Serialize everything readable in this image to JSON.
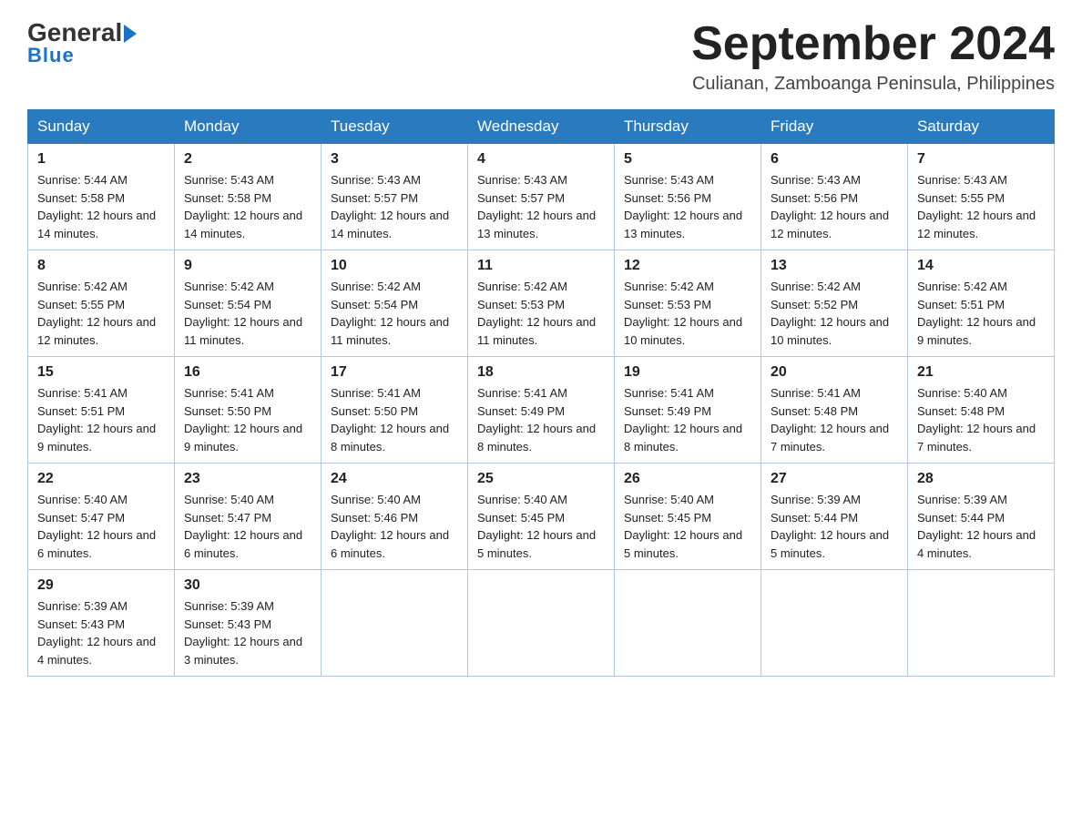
{
  "logo": {
    "general": "General",
    "blue": "Blue",
    "arrow": "▶"
  },
  "title": "September 2024",
  "location": "Culianan, Zamboanga Peninsula, Philippines",
  "weekdays": [
    "Sunday",
    "Monday",
    "Tuesday",
    "Wednesday",
    "Thursday",
    "Friday",
    "Saturday"
  ],
  "weeks": [
    [
      {
        "day": "1",
        "sunrise": "5:44 AM",
        "sunset": "5:58 PM",
        "daylight": "12 hours and 14 minutes."
      },
      {
        "day": "2",
        "sunrise": "5:43 AM",
        "sunset": "5:58 PM",
        "daylight": "12 hours and 14 minutes."
      },
      {
        "day": "3",
        "sunrise": "5:43 AM",
        "sunset": "5:57 PM",
        "daylight": "12 hours and 14 minutes."
      },
      {
        "day": "4",
        "sunrise": "5:43 AM",
        "sunset": "5:57 PM",
        "daylight": "12 hours and 13 minutes."
      },
      {
        "day": "5",
        "sunrise": "5:43 AM",
        "sunset": "5:56 PM",
        "daylight": "12 hours and 13 minutes."
      },
      {
        "day": "6",
        "sunrise": "5:43 AM",
        "sunset": "5:56 PM",
        "daylight": "12 hours and 12 minutes."
      },
      {
        "day": "7",
        "sunrise": "5:43 AM",
        "sunset": "5:55 PM",
        "daylight": "12 hours and 12 minutes."
      }
    ],
    [
      {
        "day": "8",
        "sunrise": "5:42 AM",
        "sunset": "5:55 PM",
        "daylight": "12 hours and 12 minutes."
      },
      {
        "day": "9",
        "sunrise": "5:42 AM",
        "sunset": "5:54 PM",
        "daylight": "12 hours and 11 minutes."
      },
      {
        "day": "10",
        "sunrise": "5:42 AM",
        "sunset": "5:54 PM",
        "daylight": "12 hours and 11 minutes."
      },
      {
        "day": "11",
        "sunrise": "5:42 AM",
        "sunset": "5:53 PM",
        "daylight": "12 hours and 11 minutes."
      },
      {
        "day": "12",
        "sunrise": "5:42 AM",
        "sunset": "5:53 PM",
        "daylight": "12 hours and 10 minutes."
      },
      {
        "day": "13",
        "sunrise": "5:42 AM",
        "sunset": "5:52 PM",
        "daylight": "12 hours and 10 minutes."
      },
      {
        "day": "14",
        "sunrise": "5:42 AM",
        "sunset": "5:51 PM",
        "daylight": "12 hours and 9 minutes."
      }
    ],
    [
      {
        "day": "15",
        "sunrise": "5:41 AM",
        "sunset": "5:51 PM",
        "daylight": "12 hours and 9 minutes."
      },
      {
        "day": "16",
        "sunrise": "5:41 AM",
        "sunset": "5:50 PM",
        "daylight": "12 hours and 9 minutes."
      },
      {
        "day": "17",
        "sunrise": "5:41 AM",
        "sunset": "5:50 PM",
        "daylight": "12 hours and 8 minutes."
      },
      {
        "day": "18",
        "sunrise": "5:41 AM",
        "sunset": "5:49 PM",
        "daylight": "12 hours and 8 minutes."
      },
      {
        "day": "19",
        "sunrise": "5:41 AM",
        "sunset": "5:49 PM",
        "daylight": "12 hours and 8 minutes."
      },
      {
        "day": "20",
        "sunrise": "5:41 AM",
        "sunset": "5:48 PM",
        "daylight": "12 hours and 7 minutes."
      },
      {
        "day": "21",
        "sunrise": "5:40 AM",
        "sunset": "5:48 PM",
        "daylight": "12 hours and 7 minutes."
      }
    ],
    [
      {
        "day": "22",
        "sunrise": "5:40 AM",
        "sunset": "5:47 PM",
        "daylight": "12 hours and 6 minutes."
      },
      {
        "day": "23",
        "sunrise": "5:40 AM",
        "sunset": "5:47 PM",
        "daylight": "12 hours and 6 minutes."
      },
      {
        "day": "24",
        "sunrise": "5:40 AM",
        "sunset": "5:46 PM",
        "daylight": "12 hours and 6 minutes."
      },
      {
        "day": "25",
        "sunrise": "5:40 AM",
        "sunset": "5:45 PM",
        "daylight": "12 hours and 5 minutes."
      },
      {
        "day": "26",
        "sunrise": "5:40 AM",
        "sunset": "5:45 PM",
        "daylight": "12 hours and 5 minutes."
      },
      {
        "day": "27",
        "sunrise": "5:39 AM",
        "sunset": "5:44 PM",
        "daylight": "12 hours and 5 minutes."
      },
      {
        "day": "28",
        "sunrise": "5:39 AM",
        "sunset": "5:44 PM",
        "daylight": "12 hours and 4 minutes."
      }
    ],
    [
      {
        "day": "29",
        "sunrise": "5:39 AM",
        "sunset": "5:43 PM",
        "daylight": "12 hours and 4 minutes."
      },
      {
        "day": "30",
        "sunrise": "5:39 AM",
        "sunset": "5:43 PM",
        "daylight": "12 hours and 3 minutes."
      },
      null,
      null,
      null,
      null,
      null
    ]
  ]
}
